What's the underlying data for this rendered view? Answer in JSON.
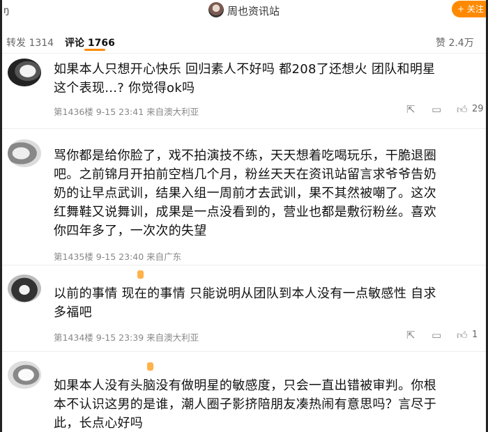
{
  "header": {
    "left_mark": "ŋ",
    "account_name": "周也资讯站",
    "follow_label": "+ 关注"
  },
  "tabs": {
    "repost": "转发 1314",
    "comment": "评论 1766",
    "like": "赞 2.4万"
  },
  "colors": {
    "accent": "#ff8a00",
    "meta_text": "#888888"
  },
  "icons": [
    "share-icon",
    "reply-icon",
    "thumbs-up-icon"
  ],
  "comments": [
    {
      "text": "如果本人只想开心快乐 回归素人不好吗 都208了还想火 团队和明星\n这个表现...? 你觉得ok吗",
      "meta": "第1436楼  9-15 23:41  来自澳大利亚",
      "likes": "29"
    },
    {
      "text": "骂你都是给你脸了，戏不拍演技不练，天天想着吃喝玩乐，干脆退圈\n吧。之前锦月开拍前空档几个月，粉丝天天在资讯站留言求爷爷告奶\n奶的让早点武训，结果入组一周前才去武训，果不其然被嘲了。这次\n红舞鞋又说舞训，成果是一点没看到的，营业也都是敷衍粉丝。喜欢\n你四年多了，一次次的失望",
      "meta": "第1435楼  9-15 23:40  来自广东",
      "likes": ""
    },
    {
      "text": "以前的事情 现在的事情 只能说明从团队到本人没有一点敏感性 自求\n多福吧",
      "meta": "第1434楼  9-15 23:39  来自澳大利亚",
      "likes": "1"
    },
    {
      "text": "如果本人没有头脑没有做明星的敏感度，只会一直出错被审判。你根\n本不认识这男的是谁，潮人圈子影挤陪朋友凑热闹有意思吗？言尽于\n此，长点心好吗",
      "meta": "",
      "likes": ""
    }
  ]
}
